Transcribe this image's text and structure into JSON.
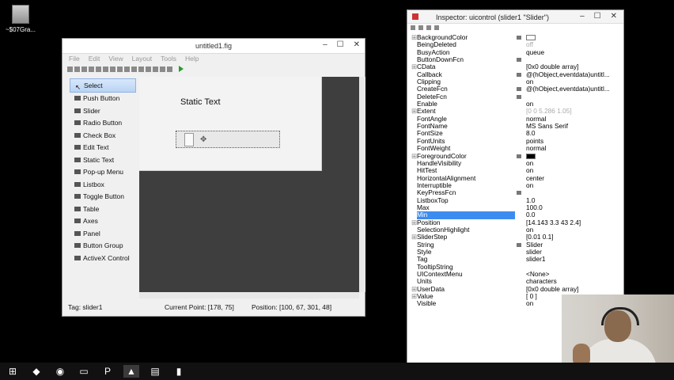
{
  "desktop": {
    "icon_label": "~$07Gra..."
  },
  "guide": {
    "title": "untitled1.fig",
    "menu": [
      "File",
      "Edit",
      "View",
      "Layout",
      "Tools",
      "Help"
    ],
    "palette": [
      {
        "label": "Select",
        "icon": "cursor-icon",
        "selected": true
      },
      {
        "label": "Push Button",
        "icon": "push-button-icon"
      },
      {
        "label": "Slider",
        "icon": "slider-icon"
      },
      {
        "label": "Radio Button",
        "icon": "radio-button-icon"
      },
      {
        "label": "Check Box",
        "icon": "check-box-icon"
      },
      {
        "label": "Edit Text",
        "icon": "edit-text-icon"
      },
      {
        "label": "Static Text",
        "icon": "static-text-icon"
      },
      {
        "label": "Pop-up Menu",
        "icon": "popup-menu-icon"
      },
      {
        "label": "Listbox",
        "icon": "listbox-icon"
      },
      {
        "label": "Toggle Button",
        "icon": "toggle-button-icon"
      },
      {
        "label": "Table",
        "icon": "table-icon"
      },
      {
        "label": "Axes",
        "icon": "axes-icon"
      },
      {
        "label": "Panel",
        "icon": "panel-icon"
      },
      {
        "label": "Button Group",
        "icon": "button-group-icon"
      },
      {
        "label": "ActiveX Control",
        "icon": "activex-icon"
      }
    ],
    "canvas": {
      "static_text": "Static Text"
    },
    "status": {
      "tag": "Tag: slider1",
      "current_point": "Current Point:  [178, 75]",
      "position": "Position: [100, 67, 301, 48]"
    }
  },
  "inspector": {
    "title": "Inspector:  uicontrol (slider1 \"Slider\")",
    "properties": [
      {
        "name": "BackgroundColor",
        "value": "",
        "swatch": "light",
        "expandable": true,
        "button": true
      },
      {
        "name": "BeingDeleted",
        "value": "off",
        "gray": true
      },
      {
        "name": "BusyAction",
        "value": "queue"
      },
      {
        "name": "ButtonDownFcn",
        "value": "",
        "button": true
      },
      {
        "name": "CData",
        "value": "[0x0  double array]",
        "expandable": true
      },
      {
        "name": "Callback",
        "value": "@(hObject,eventdata)untitl...",
        "button": true
      },
      {
        "name": "Clipping",
        "value": "on"
      },
      {
        "name": "CreateFcn",
        "value": "@(hObject,eventdata)untitl...",
        "button": true
      },
      {
        "name": "DeleteFcn",
        "value": "",
        "button": true
      },
      {
        "name": "Enable",
        "value": "on"
      },
      {
        "name": "Extent",
        "value": "[0 0 5.286 1.05]",
        "gray": true,
        "expandable": true
      },
      {
        "name": "FontAngle",
        "value": "normal"
      },
      {
        "name": "FontName",
        "value": "MS Sans Serif"
      },
      {
        "name": "FontSize",
        "value": "8.0"
      },
      {
        "name": "FontUnits",
        "value": "points"
      },
      {
        "name": "FontWeight",
        "value": "normal"
      },
      {
        "name": "ForegroundColor",
        "value": "",
        "swatch": "dark",
        "expandable": true,
        "button": true
      },
      {
        "name": "HandleVisibility",
        "value": "on"
      },
      {
        "name": "HitTest",
        "value": "on"
      },
      {
        "name": "HorizontalAlignment",
        "value": "center"
      },
      {
        "name": "Interruptible",
        "value": "on"
      },
      {
        "name": "KeyPressFcn",
        "value": "",
        "button": true
      },
      {
        "name": "ListboxTop",
        "value": "1.0"
      },
      {
        "name": "Max",
        "value": "100.0"
      },
      {
        "name": "Min",
        "value": "0.0",
        "selected": true
      },
      {
        "name": "Position",
        "value": "[14.143 3.3 43 2.4]",
        "expandable": true
      },
      {
        "name": "SelectionHighlight",
        "value": "on"
      },
      {
        "name": "SliderStep",
        "value": "[0.01 0.1]",
        "expandable": true
      },
      {
        "name": "String",
        "value": "Slider",
        "button": true
      },
      {
        "name": "Style",
        "value": "slider"
      },
      {
        "name": "Tag",
        "value": "slider1"
      },
      {
        "name": "TooltipString",
        "value": ""
      },
      {
        "name": "UIContextMenu",
        "value": "<None>"
      },
      {
        "name": "Units",
        "value": "characters"
      },
      {
        "name": "UserData",
        "value": "[0x0  double array]",
        "expandable": true
      },
      {
        "name": "Value",
        "value": "[ 0 ]",
        "expandable": true
      },
      {
        "name": "Visible",
        "value": "on"
      }
    ]
  },
  "taskbar": {
    "items": [
      {
        "icon": "windows-start-icon",
        "glyph": "⊞"
      },
      {
        "icon": "dropbox-icon",
        "glyph": "◆"
      },
      {
        "icon": "chrome-icon",
        "glyph": "◉"
      },
      {
        "icon": "file-explorer-icon",
        "glyph": "▭"
      },
      {
        "icon": "powerpoint-icon",
        "glyph": "P"
      },
      {
        "icon": "matlab-icon",
        "glyph": "▲",
        "active": true
      },
      {
        "icon": "folder-icon",
        "glyph": "▤"
      },
      {
        "icon": "app-icon",
        "glyph": "▮"
      }
    ]
  }
}
